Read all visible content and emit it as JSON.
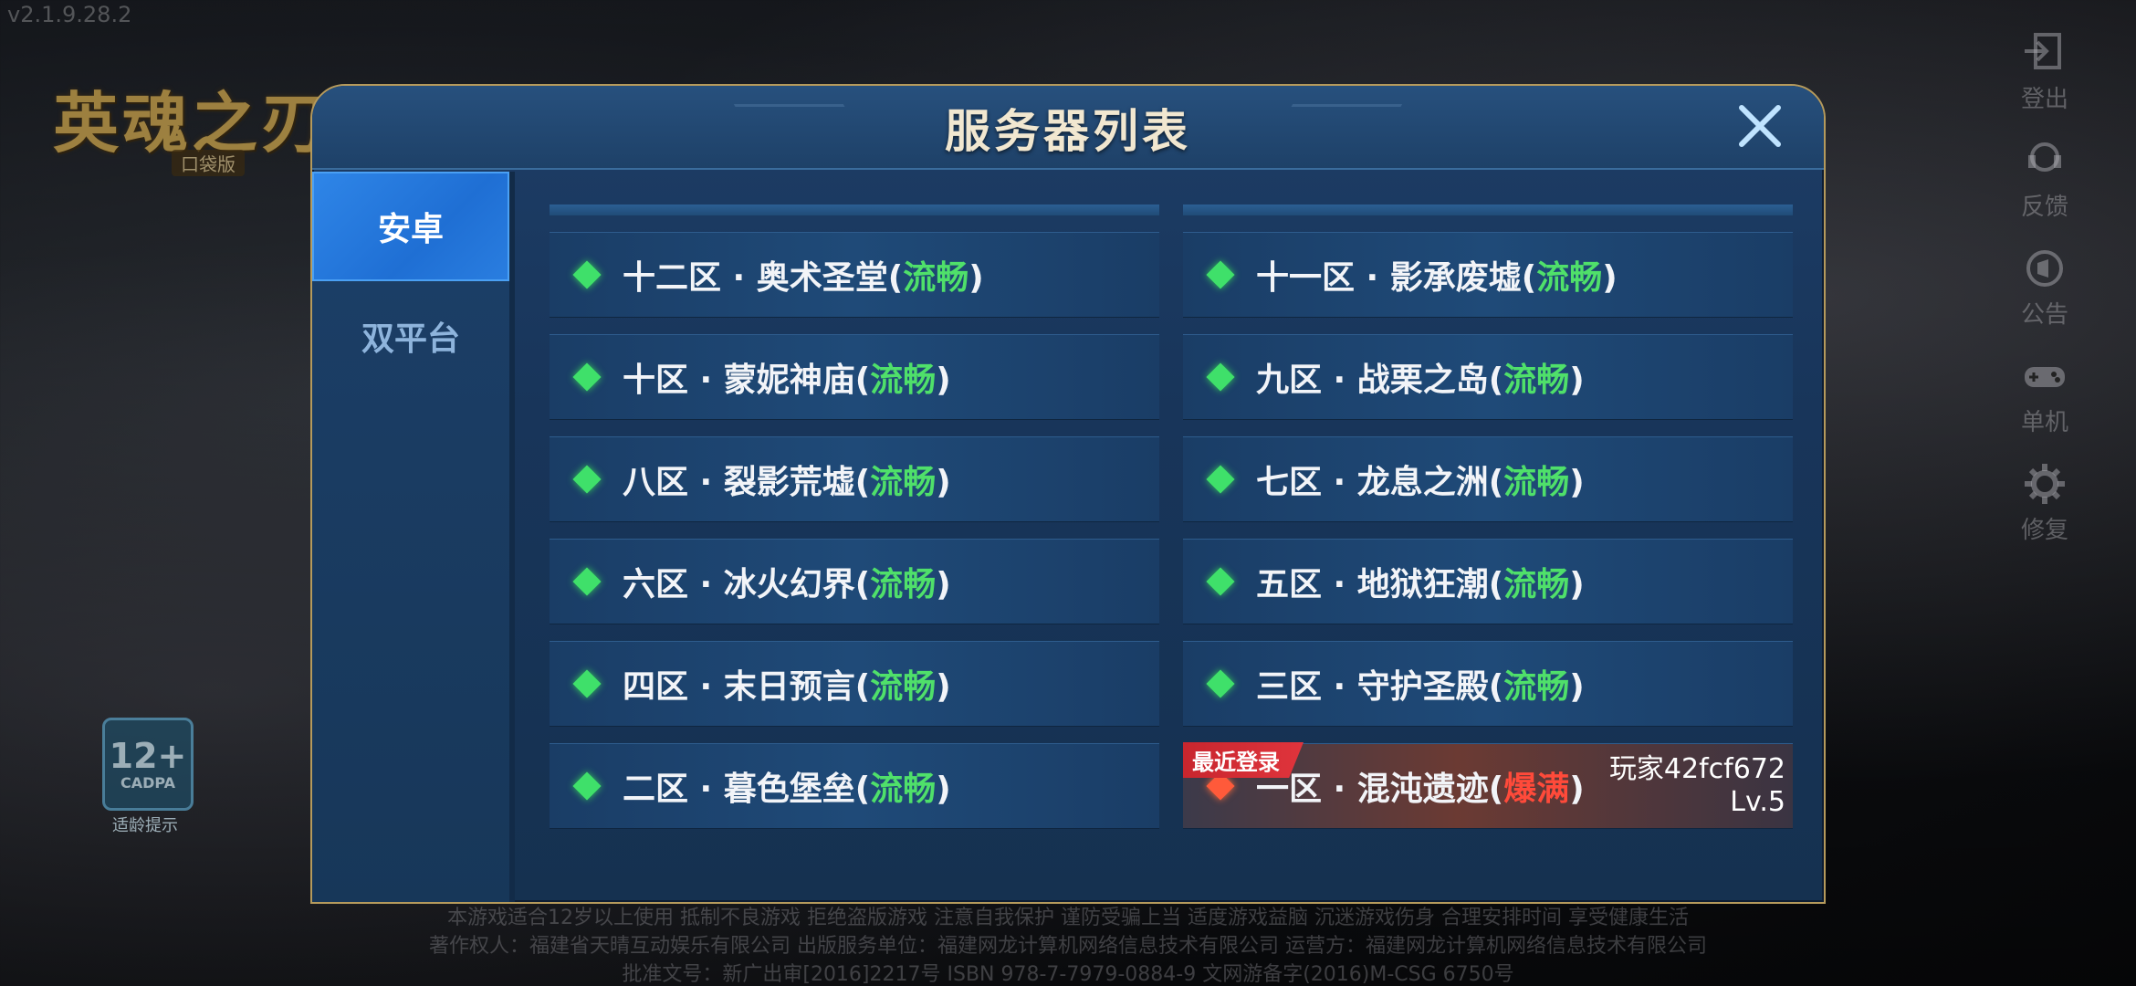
{
  "version": "v2.1.9.28.2",
  "logo": {
    "title": "英魂之刃",
    "subtitle": "口袋版"
  },
  "side_menu": [
    {
      "label": "登出",
      "icon": "logout-icon"
    },
    {
      "label": "反馈",
      "icon": "feedback-icon"
    },
    {
      "label": "公告",
      "icon": "announcement-icon"
    },
    {
      "label": "单机",
      "icon": "gamepad-icon"
    },
    {
      "label": "修复",
      "icon": "gear-icon"
    }
  ],
  "age_badge": {
    "number": "12+",
    "org": "CADPA",
    "tip": "适龄提示"
  },
  "footer": {
    "line1": "本游戏适合12岁以上使用 抵制不良游戏 拒绝盗版游戏 注意自我保护 谨防受骗上当 适度游戏益脑 沉迷游戏伤身 合理安排时间 享受健康生活",
    "line2": "著作权人：福建省天晴互动娱乐有限公司 出版服务单位：福建网龙计算机网络信息技术有限公司 运营方：福建网龙计算机网络信息技术有限公司",
    "line3": "批准文号：新广出审[2016]2217号 ISBN 978-7-7979-0884-9 文网游备字(2016)M-CSG 6750号"
  },
  "dialog": {
    "title": "服务器列表",
    "tabs": [
      {
        "label": "安卓",
        "active": true
      },
      {
        "label": "双平台",
        "active": false
      }
    ],
    "servers": [
      {
        "name": "十二区 · 奥术圣堂",
        "status": "流畅",
        "state": "smooth"
      },
      {
        "name": "十一区 · 影承废墟",
        "status": "流畅",
        "state": "smooth"
      },
      {
        "name": "十区 · 蒙妮神庙",
        "status": "流畅",
        "state": "smooth"
      },
      {
        "name": "九区 · 战栗之岛",
        "status": "流畅",
        "state": "smooth"
      },
      {
        "name": "八区 · 裂影荒墟",
        "status": "流畅",
        "state": "smooth"
      },
      {
        "name": "七区 · 龙息之洲",
        "status": "流畅",
        "state": "smooth"
      },
      {
        "name": "六区 · 冰火幻界",
        "status": "流畅",
        "state": "smooth"
      },
      {
        "name": "五区 · 地狱狂潮",
        "status": "流畅",
        "state": "smooth"
      },
      {
        "name": "四区 · 末日预言",
        "status": "流畅",
        "state": "smooth"
      },
      {
        "name": "三区 · 守护圣殿",
        "status": "流畅",
        "state": "smooth"
      },
      {
        "name": "二区 · 暮色堡垒",
        "status": "流畅",
        "state": "smooth"
      },
      {
        "name": "一区 · 混沌遗迹",
        "status": "爆满",
        "state": "full",
        "recent_tag": "最近登录",
        "player": "玩家42fcf672",
        "level": "Lv.5"
      }
    ]
  },
  "colors": {
    "smooth": "#4fe06a",
    "full": "#ff4a3a",
    "active_tab": "#2f86e8",
    "title": "#f1e7d0"
  }
}
